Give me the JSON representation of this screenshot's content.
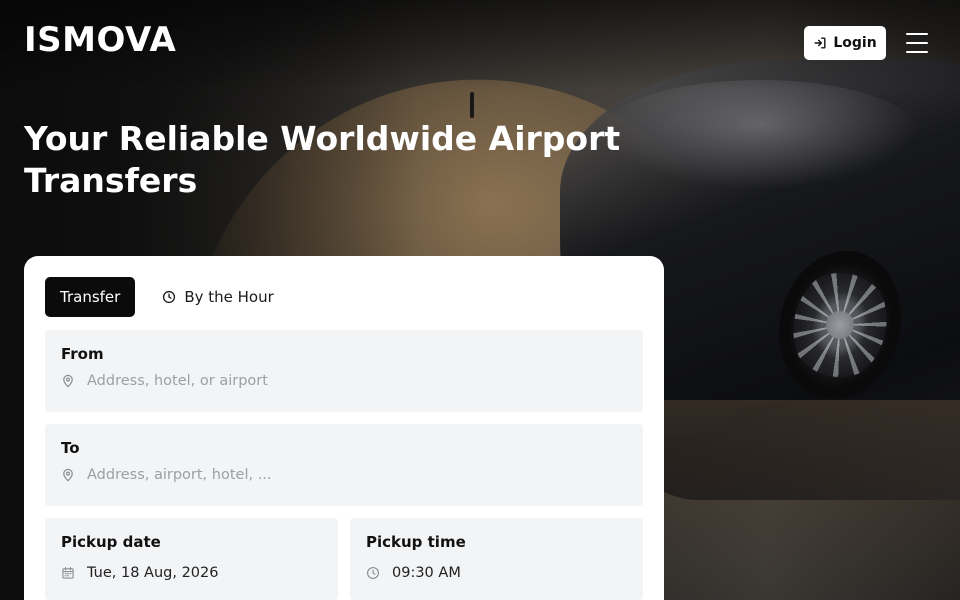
{
  "brand": {
    "name": "ISMOVA"
  },
  "header": {
    "login_label": "Login",
    "login_icon": "login-icon",
    "menu_icon": "hamburger-menu-icon"
  },
  "hero": {
    "title_line1": "Your Reliable Worldwide Airport",
    "title_line2": "Transfers"
  },
  "booking": {
    "tabs": [
      {
        "label": "Transfer",
        "active": true
      },
      {
        "label": "By the Hour",
        "active": false,
        "icon": "clock-icon"
      }
    ],
    "from": {
      "label": "From",
      "placeholder": "Address, hotel, or airport",
      "icon": "map-pin-icon"
    },
    "to": {
      "label": "To",
      "placeholder": "Address, airport, hotel, ...",
      "icon": "map-pin-icon"
    },
    "pickup_date": {
      "label": "Pickup date",
      "value": "Tue, 18 Aug, 2026",
      "icon": "calendar-icon"
    },
    "pickup_time": {
      "label": "Pickup time",
      "value": "09:30 AM",
      "icon": "clock-icon"
    }
  },
  "colors": {
    "accent": "#0b0b0b",
    "field_bg": "#f3f4f6",
    "placeholder": "#9aa0a6",
    "card_bg": "#ffffff"
  }
}
